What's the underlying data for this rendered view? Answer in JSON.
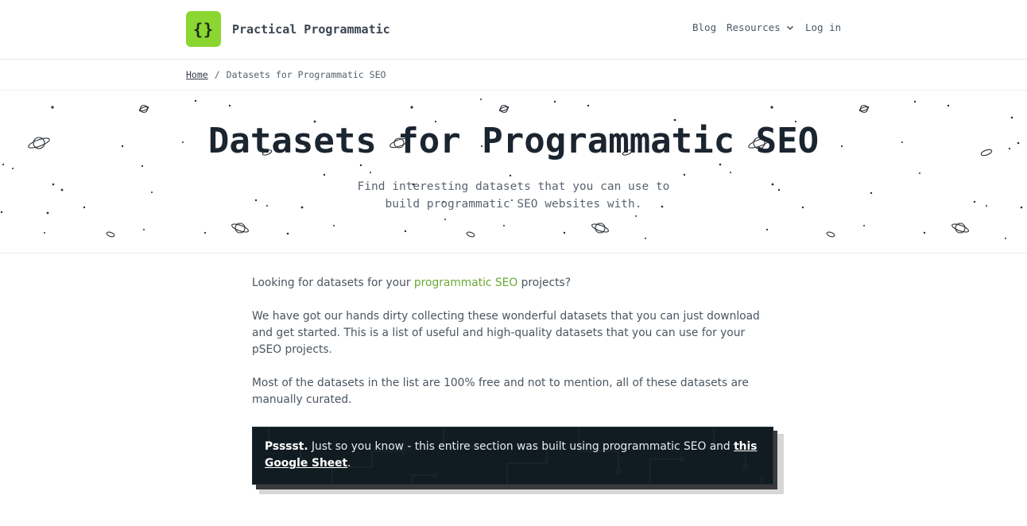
{
  "header": {
    "logo_glyph": "{}",
    "brand": "Practical Programmatic",
    "nav": {
      "blog": "Blog",
      "resources": "Resources",
      "login": "Log in"
    },
    "accent_color": "#8bd630"
  },
  "breadcrumb": {
    "home": "Home",
    "separator": "/",
    "current": "Datasets for Programmatic SEO"
  },
  "hero": {
    "title": "Datasets for Programmatic SEO",
    "subtitle_line1": "Find interesting datasets that you can use to",
    "subtitle_line2": "build programmatic SEO websites with."
  },
  "content": {
    "p1_before": "Looking for datasets for your ",
    "p1_link": "programmatic SEO",
    "p1_after": " projects?",
    "p2": "We have got our hands dirty collecting these wonderful datasets that you can just download and get started. This is a list of useful and high-quality datasets that you can use for your pSEO projects.",
    "p3": "Most of the datasets in the list are 100% free and not to mention, all of these datasets are manually curated.",
    "link_color": "#6aa933"
  },
  "callout": {
    "lead": "Psssst.",
    "text": " Just so you know - this entire section was built using programmatic SEO and ",
    "link": "this Google Sheet",
    "end": "."
  }
}
